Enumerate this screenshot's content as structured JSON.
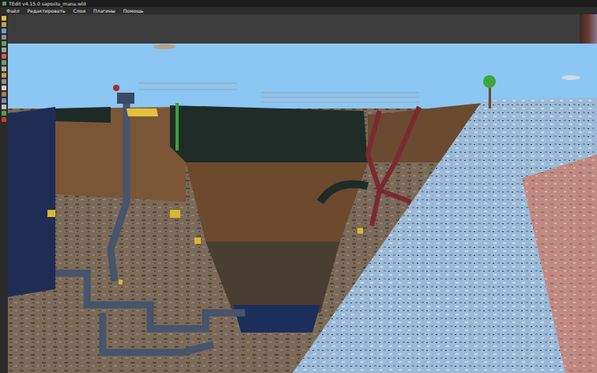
{
  "window": {
    "title": "TEdit v4.15.0 sapostu_mana.wld"
  },
  "menu": [
    {
      "label": "Файл"
    },
    {
      "label": "Редактировать"
    },
    {
      "label": "Слои"
    },
    {
      "label": "Плагины"
    },
    {
      "label": "Помощь"
    }
  ]
}
